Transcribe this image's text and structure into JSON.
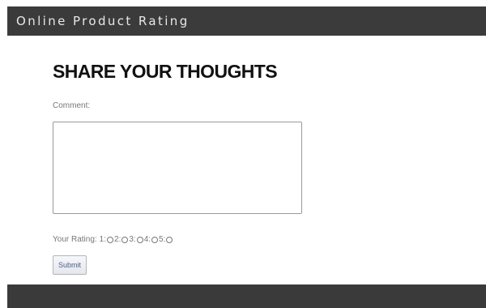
{
  "header": {
    "title": "Online Product Rating",
    "background_color": "#3b3b3b"
  },
  "form": {
    "heading": "SHARE YOUR THOUGHTS",
    "comment_label": "Comment:",
    "comment_value": "",
    "rating_label": "Your Rating:",
    "rating_options": [
      "1:",
      "2:",
      "3:",
      "4:",
      "5:"
    ],
    "rating_selected": null,
    "submit_label": "Submit"
  },
  "footer": {
    "background_color": "#3a3a3a"
  }
}
